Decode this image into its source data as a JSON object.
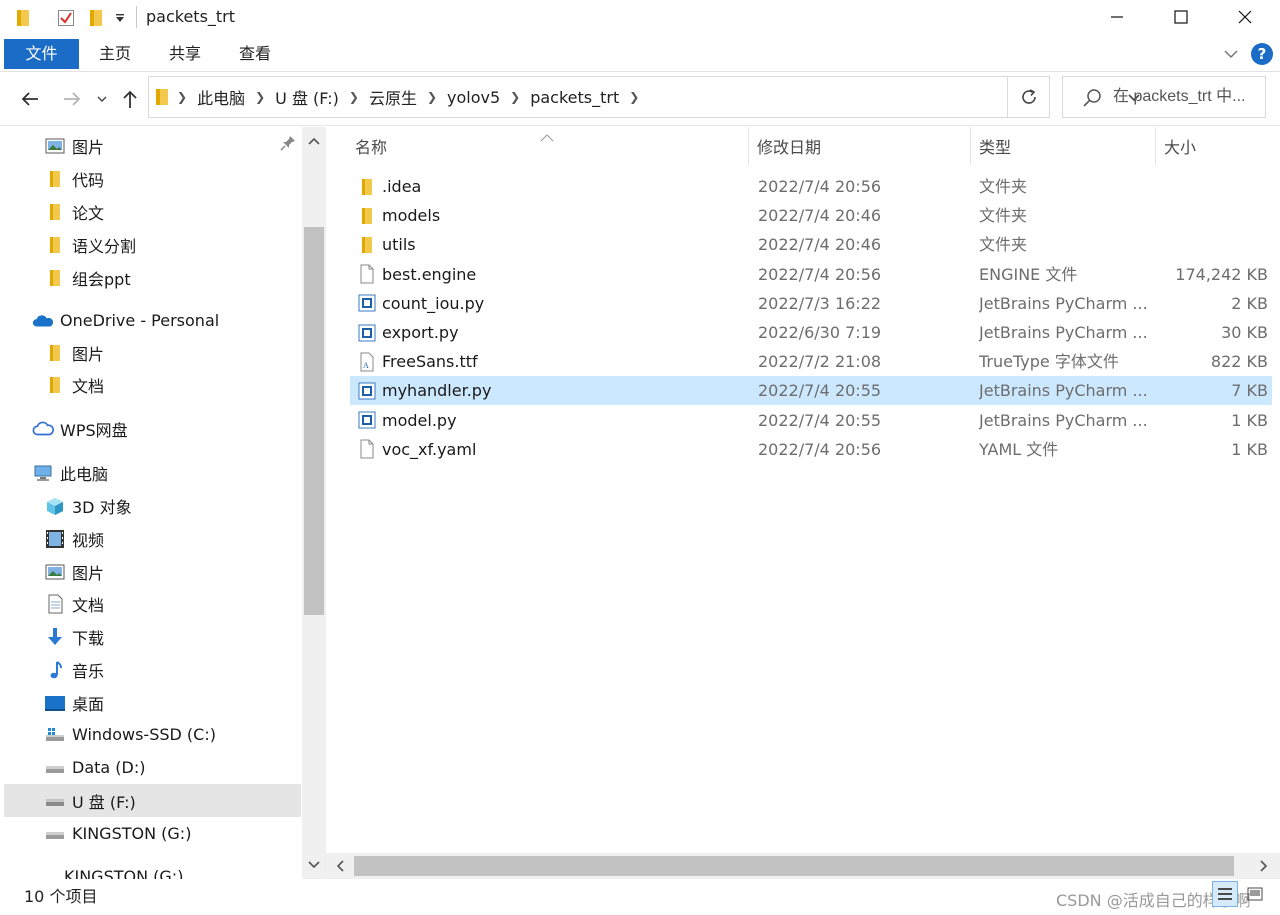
{
  "window": {
    "title": "packets_trt"
  },
  "ribbon": {
    "tabs": [
      "文件",
      "主页",
      "共享",
      "查看"
    ],
    "help": "?"
  },
  "nav": {
    "path": [
      "此电脑",
      "U 盘 (F:)",
      "云原生",
      "yolov5",
      "packets_trt"
    ]
  },
  "search": {
    "placeholder": "在 packets_trt 中..."
  },
  "sidebar": {
    "items": [
      {
        "label": "图片",
        "icon": "pictures-icon"
      },
      {
        "label": "代码",
        "icon": "folder-icon"
      },
      {
        "label": "论文",
        "icon": "folder-icon"
      },
      {
        "label": "语义分割",
        "icon": "folder-icon"
      },
      {
        "label": "组会ppt",
        "icon": "folder-icon"
      },
      {
        "label": "OneDrive - Personal",
        "icon": "onedrive-icon"
      },
      {
        "label": "图片",
        "icon": "folder-icon"
      },
      {
        "label": "文档",
        "icon": "folder-icon"
      },
      {
        "label": "WPS网盘",
        "icon": "wps-cloud-icon"
      },
      {
        "label": "此电脑",
        "icon": "computer-icon"
      },
      {
        "label": "3D 对象",
        "icon": "3d-objects-icon"
      },
      {
        "label": "视频",
        "icon": "videos-icon"
      },
      {
        "label": "图片",
        "icon": "pictures-icon"
      },
      {
        "label": "文档",
        "icon": "documents-icon"
      },
      {
        "label": "下载",
        "icon": "downloads-icon"
      },
      {
        "label": "音乐",
        "icon": "music-icon"
      },
      {
        "label": "桌面",
        "icon": "desktop-icon"
      },
      {
        "label": "Windows-SSD (C:)",
        "icon": "windows-drive-icon"
      },
      {
        "label": "Data (D:)",
        "icon": "drive-icon"
      },
      {
        "label": "U 盘 (F:)",
        "icon": "usb-drive-icon"
      },
      {
        "label": "KINGSTON (G:)",
        "icon": "usb-drive-icon"
      },
      {
        "label": "KINGSTON (G:)",
        "icon": "usb-drive-icon"
      }
    ],
    "selected_label": "U 盘 (F:)"
  },
  "columns": {
    "name": "名称",
    "date": "修改日期",
    "type": "类型",
    "size": "大小"
  },
  "files": [
    {
      "name": ".idea",
      "date": "2022/7/4 20:56",
      "type": "文件夹",
      "size": "",
      "icon": "folder-icon"
    },
    {
      "name": "models",
      "date": "2022/7/4 20:46",
      "type": "文件夹",
      "size": "",
      "icon": "folder-icon"
    },
    {
      "name": "utils",
      "date": "2022/7/4 20:46",
      "type": "文件夹",
      "size": "",
      "icon": "folder-icon"
    },
    {
      "name": "best.engine",
      "date": "2022/7/4 20:56",
      "type": "ENGINE 文件",
      "size": "174,242 KB",
      "icon": "blank-file-icon"
    },
    {
      "name": "count_iou.py",
      "date": "2022/7/3 16:22",
      "type": "JetBrains PyCharm ...",
      "size": "2 KB",
      "icon": "python-file-icon"
    },
    {
      "name": "export.py",
      "date": "2022/6/30 7:19",
      "type": "JetBrains PyCharm ...",
      "size": "30 KB",
      "icon": "python-file-icon"
    },
    {
      "name": "FreeSans.ttf",
      "date": "2022/7/2 21:08",
      "type": "TrueType 字体文件",
      "size": "822 KB",
      "icon": "font-file-icon"
    },
    {
      "name": "myhandler.py",
      "date": "2022/7/4 20:55",
      "type": "JetBrains PyCharm ...",
      "size": "7 KB",
      "icon": "python-file-icon",
      "selected": true
    },
    {
      "name": "model.py",
      "date": "2022/7/4 20:55",
      "type": "JetBrains PyCharm ...",
      "size": "1 KB",
      "icon": "python-file-icon"
    },
    {
      "name": "voc_xf.yaml",
      "date": "2022/7/4 20:56",
      "type": "YAML 文件",
      "size": "1 KB",
      "icon": "blank-file-icon"
    }
  ],
  "status": {
    "count": "10 个项目",
    "watermark": "CSDN @活成自己的样子啊"
  },
  "colors": {
    "accent": "#1a6cc6",
    "selection": "#cce8ff",
    "folder": "#f2c94c"
  }
}
